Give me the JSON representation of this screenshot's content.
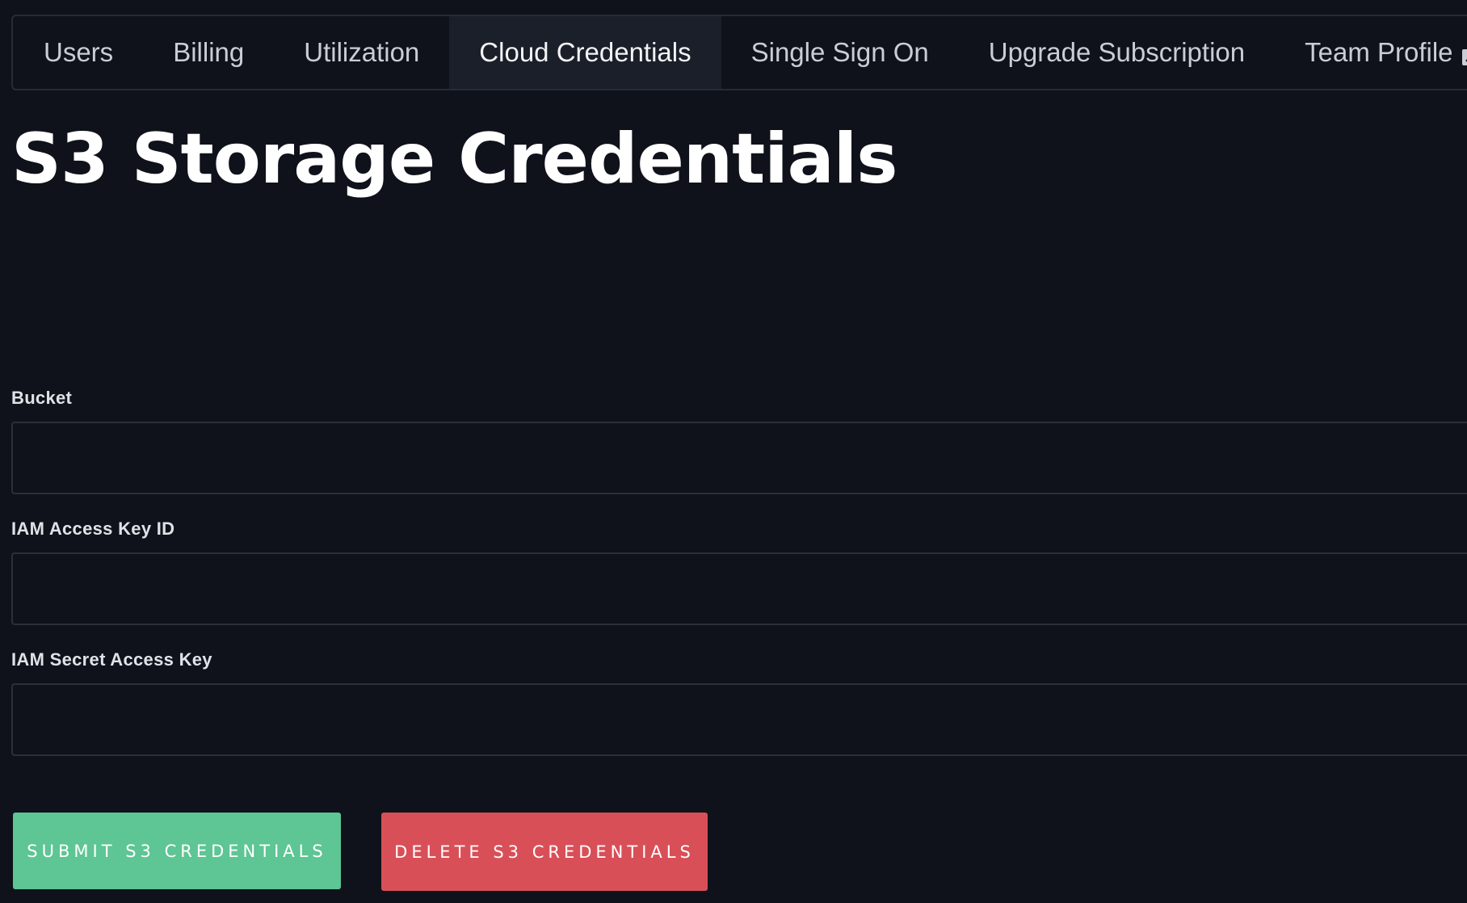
{
  "tabs": [
    {
      "label": "Users"
    },
    {
      "label": "Billing"
    },
    {
      "label": "Utilization"
    },
    {
      "label": "Cloud Credentials",
      "active": true
    },
    {
      "label": "Single Sign On"
    },
    {
      "label": "Upgrade Subscription"
    },
    {
      "label": "Team Profile",
      "icon": "external-link-icon"
    }
  ],
  "page": {
    "title": "S3 Storage Credentials"
  },
  "form": {
    "bucket": {
      "label": "Bucket",
      "value": "",
      "placeholder": ""
    },
    "access_key_id": {
      "label": "IAM Access Key ID",
      "value": "",
      "placeholder": ""
    },
    "secret_access_key": {
      "label": "IAM Secret Access Key",
      "value": "",
      "placeholder": ""
    }
  },
  "buttons": {
    "submit_label": "SUBMIT S3 CREDENTIALS",
    "delete_label": "DELETE S3 CREDENTIALS"
  },
  "colors": {
    "background": "#0f121a",
    "active_tab": "#1b1f29",
    "submit": "#5ec595",
    "delete": "#d94f57"
  }
}
